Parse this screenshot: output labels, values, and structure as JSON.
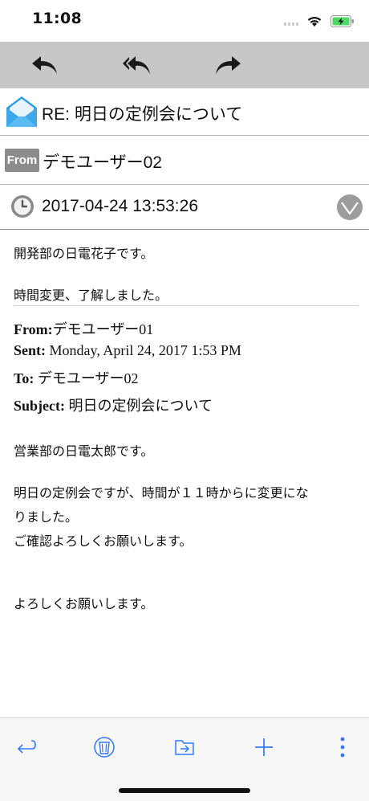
{
  "status": {
    "time": "11:08"
  },
  "toolbar": {
    "reply": "reply-icon",
    "reply_all": "reply-all-icon",
    "forward": "forward-icon"
  },
  "email": {
    "subject": "RE: 明日の定例会について",
    "from_badge": "From",
    "from": "デモユーザー02",
    "date": "2017-04-24 13:53:26"
  },
  "body": {
    "line1": "開発部の日電花子です。",
    "line2": "時間変更、了解しました。",
    "quoted": {
      "from_label": "From:",
      "from_value": "デモユーザー01",
      "sent_label": "Sent:",
      "sent_value": "Monday, April 24, 2017 1:53 PM",
      "to_label": "To:",
      "to_value": "デモユーザー02",
      "subject_label": "Subject:",
      "subject_value": "明日の定例会について"
    },
    "line3": "営業部の日電太郎です。",
    "line4": "明日の定例会ですが、時間が１１時からに変更にな",
    "line5": "りました。",
    "line6": "ご確認よろしくお願いします。",
    "line7": "よろしくお願いします。"
  },
  "bottom_bar": {
    "icons": [
      "return-icon",
      "trash-icon",
      "move-to-folder-icon",
      "add-icon",
      "more-icon"
    ],
    "accent": "#3478f6"
  }
}
